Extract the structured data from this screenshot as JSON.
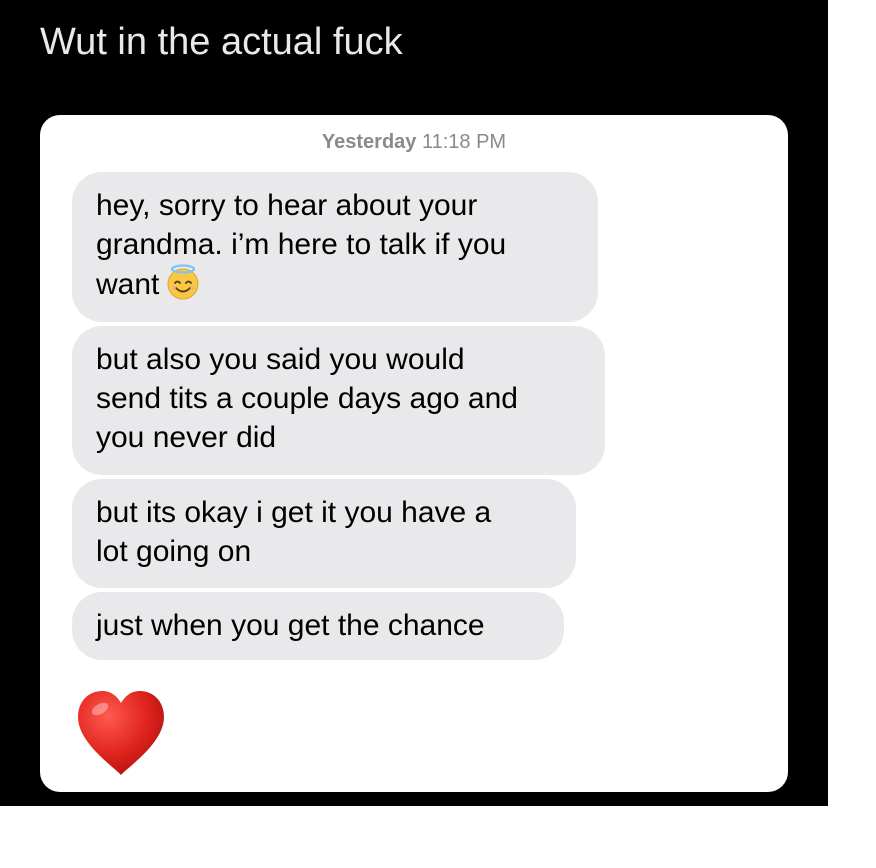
{
  "post": {
    "caption": "Wut in the actual fuck"
  },
  "conversation": {
    "timestamp_day": "Yesterday",
    "timestamp_time": "11:18 PM",
    "messages": [
      {
        "lines": [
          "hey, sorry to hear about your",
          "grandma. i’m here to talk if you",
          "want"
        ],
        "trailing_emoji": "smiling-face-with-halo-icon"
      },
      {
        "lines": [
          "but also you said you would",
          "send tits a couple days ago and",
          "you never did"
        ]
      },
      {
        "lines": [
          "but its okay i get it you have a",
          "lot going on"
        ]
      },
      {
        "lines": [
          "just when you get the chance"
        ]
      }
    ],
    "reaction": "red-heart-icon"
  },
  "colors": {
    "page_background": "#000000",
    "card_background": "#ffffff",
    "received_bubble": "#e9e9eb",
    "timestamp_text": "#8a8a8e",
    "heart": "#e0241e"
  }
}
